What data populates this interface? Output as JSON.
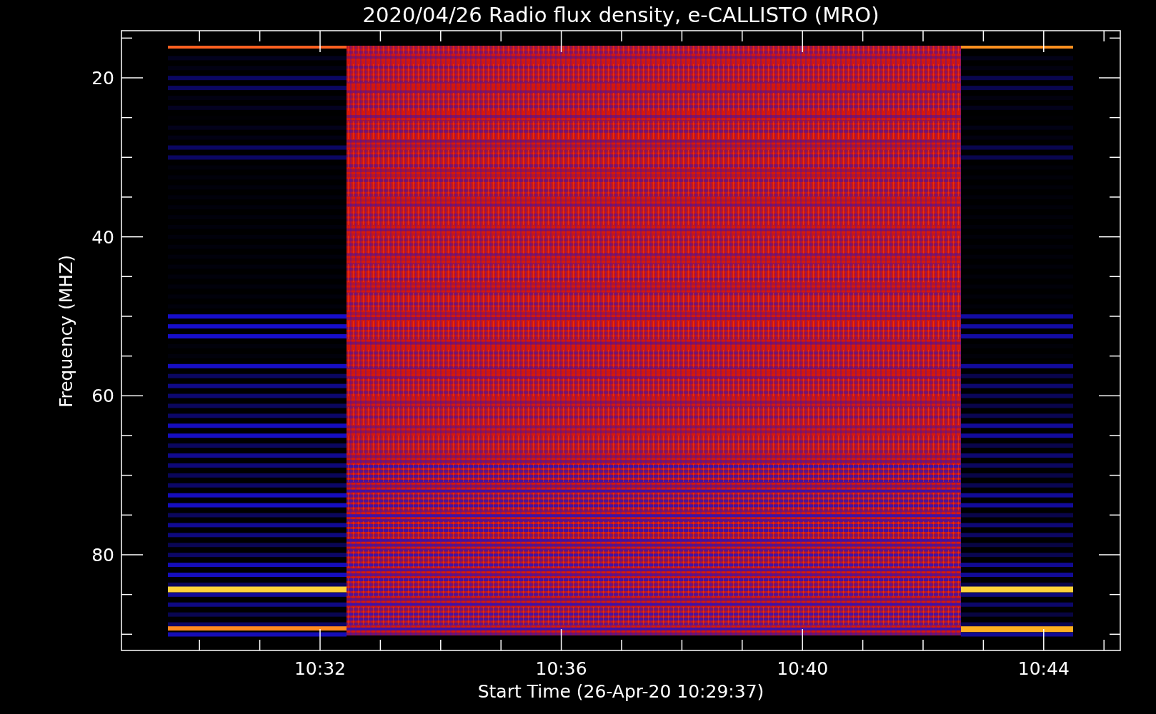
{
  "title": "2020/04/26  Radio flux density, e-CALLISTO (MRO)",
  "y_axis": {
    "label": "Frequency (MHZ)",
    "ticks": [
      "20",
      "40",
      "60",
      "80"
    ]
  },
  "x_axis": {
    "label": "Start Time (26-Apr-20 10:29:37)",
    "ticks": [
      "10:32",
      "10:36",
      "10:40",
      "10:44"
    ]
  }
}
